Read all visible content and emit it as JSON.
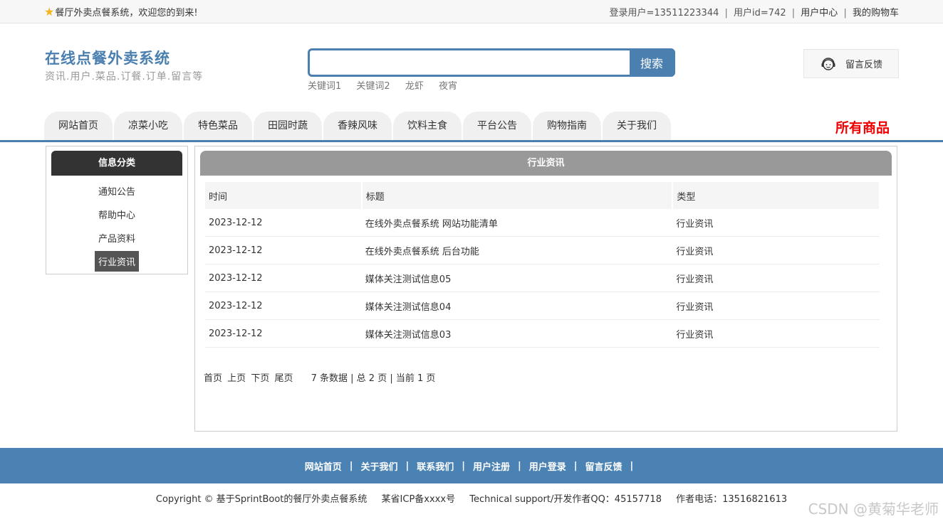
{
  "topbar": {
    "welcome": "餐厅外卖点餐系统，欢迎您的到来!",
    "login_user": "登录用户=13511223344",
    "user_id": "用户id=742",
    "user_center": "用户中心",
    "cart": "我的购物车",
    "separator": "|"
  },
  "header": {
    "title": "在线点餐外卖系统",
    "subtitle": "资讯.用户.菜品.订餐.订单.留言等",
    "search_button": "搜索",
    "search_value": "",
    "keywords": [
      "关键词1",
      "关键词2",
      "龙虾",
      "夜宵"
    ],
    "feedback": "留言反馈"
  },
  "nav": {
    "items": [
      "网站首页",
      "凉菜小吃",
      "特色菜品",
      "田园时蔬",
      "香辣风味",
      "饮料主食",
      "平台公告",
      "购物指南",
      "关于我们"
    ],
    "all_goods": "所有商品"
  },
  "sidebar": {
    "title": "信息分类",
    "items": [
      "通知公告",
      "帮助中心",
      "产品资料",
      "行业资讯"
    ],
    "active_index": 3
  },
  "main": {
    "title": "行业资讯",
    "columns": [
      "时间",
      "标题",
      "类型"
    ],
    "rows": [
      [
        "2023-12-12",
        "在线外卖点餐系统 网站功能清单",
        "行业资讯"
      ],
      [
        "2023-12-12",
        "在线外卖点餐系统 后台功能",
        "行业资讯"
      ],
      [
        "2023-12-12",
        "媒体关注测试信息05",
        "行业资讯"
      ],
      [
        "2023-12-12",
        "媒体关注测试信息04",
        "行业资讯"
      ],
      [
        "2023-12-12",
        "媒体关注测试信息03",
        "行业资讯"
      ]
    ],
    "pager": {
      "first": "首页",
      "prev": "上页",
      "next": "下页",
      "last": "尾页",
      "info": "7 条数据 | 总 2 页 | 当前 1 页"
    }
  },
  "footer": {
    "links": [
      "网站首页",
      "关于我们",
      "联系我们",
      "用户注册",
      "用户登录",
      "留言反馈"
    ],
    "separator": "|",
    "copyright": "Copyright © 基于SprintBoot的餐厅外卖点餐系统",
    "icp": "某省ICP备xxxx号",
    "support": "Technical support/开发作者QQ：45157718",
    "phone": "作者电话：13516821613"
  },
  "watermark": "CSDN @黄菊华老师",
  "colors": {
    "accent": "#4a7fb0",
    "footer": "#4a82b4",
    "all_goods": "#f00000",
    "sidebar_head": "#333333",
    "main_head": "#999999"
  },
  "icons": {
    "welcome": "star-icon",
    "feedback": "headset-icon"
  }
}
